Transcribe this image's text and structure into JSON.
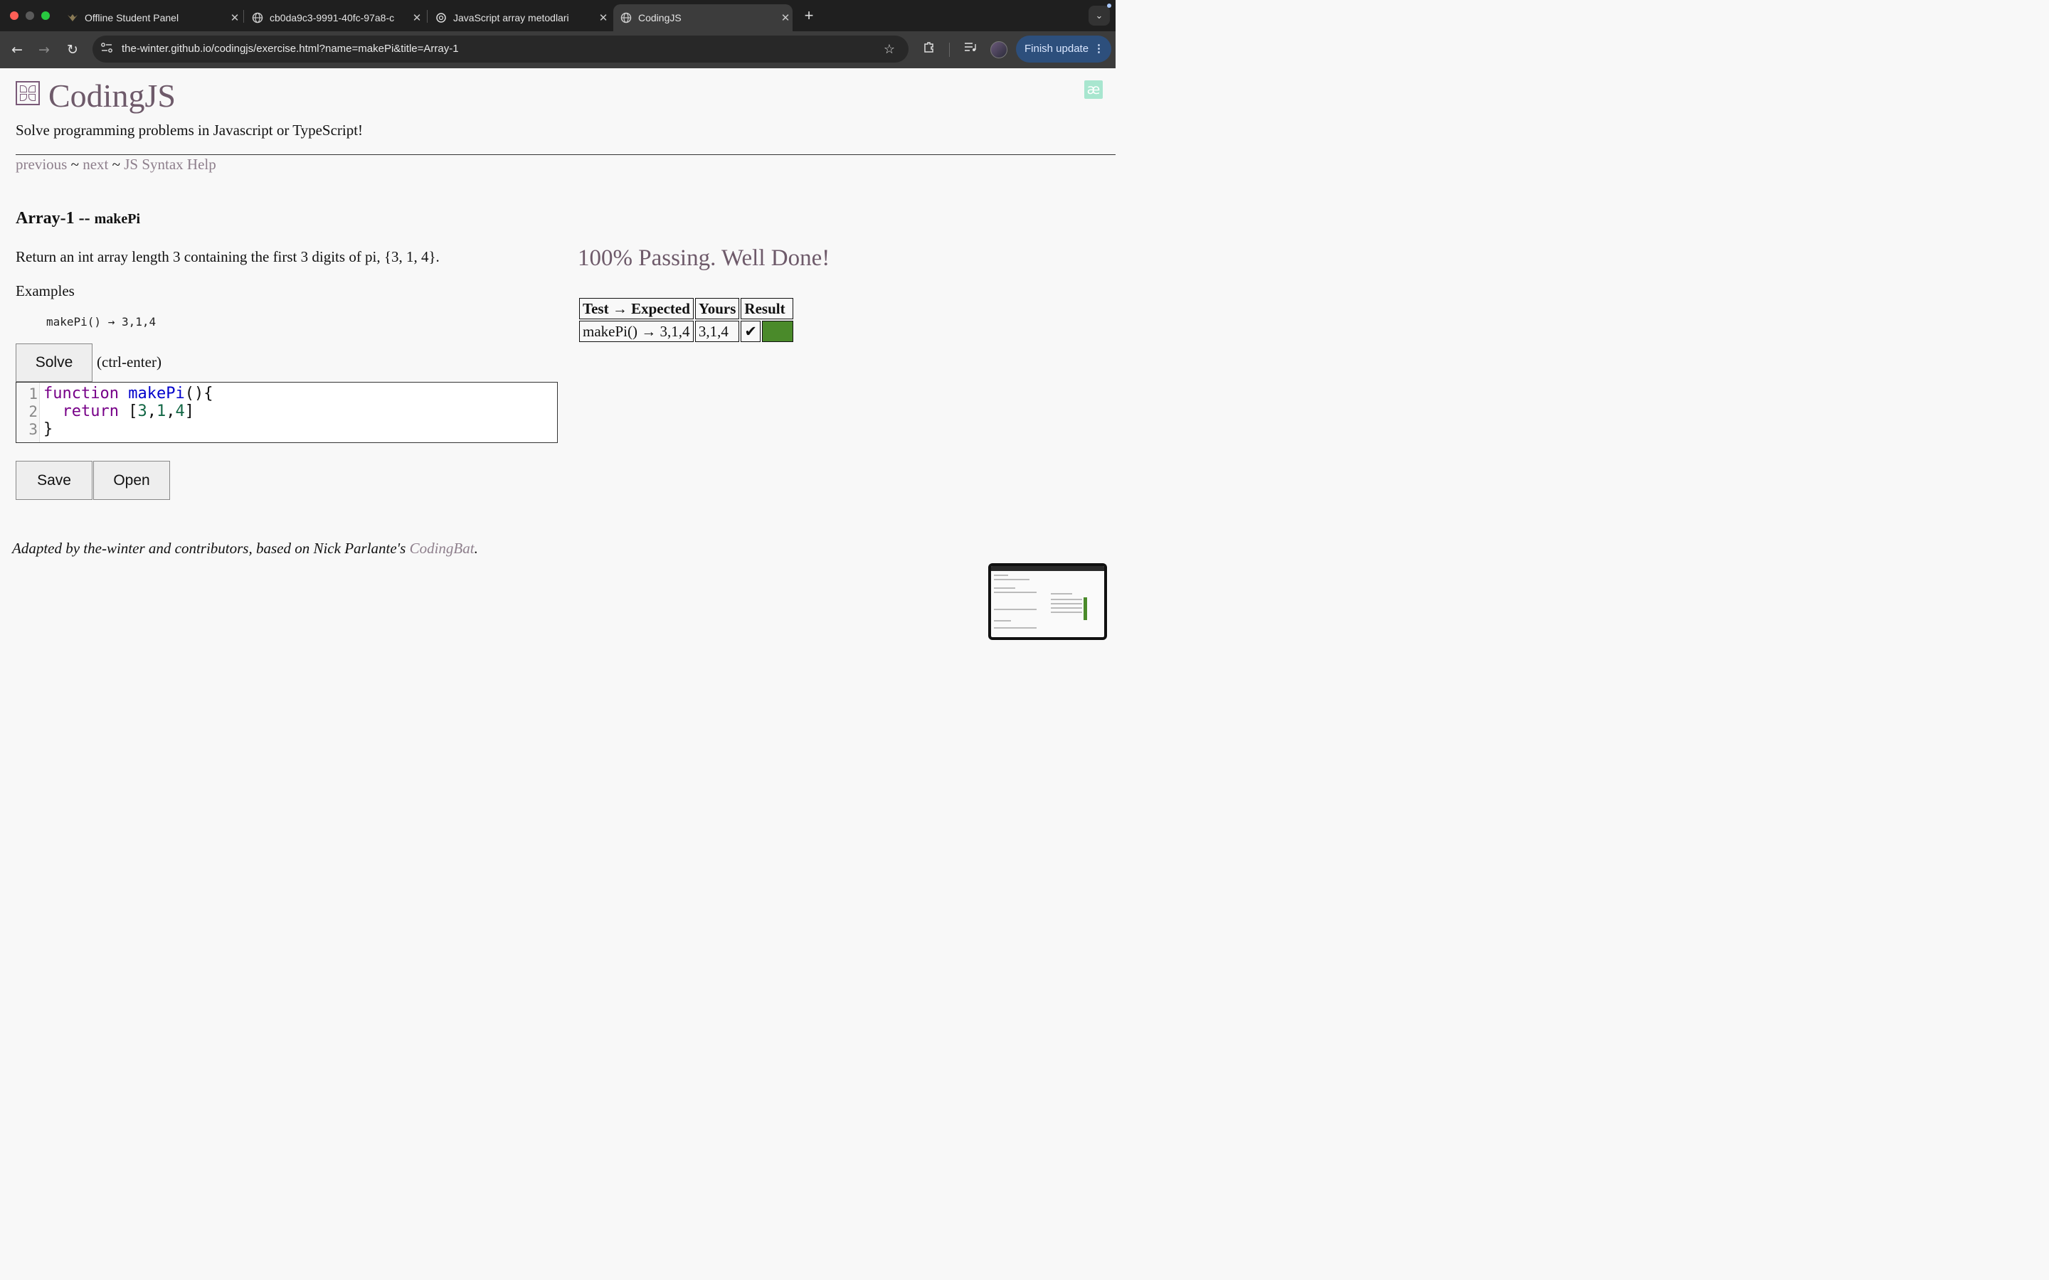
{
  "browser": {
    "tabs": [
      {
        "title": "Offline Student Panel",
        "icon": "paw-icon",
        "active": false
      },
      {
        "title": "cb0da9c3-9991-40fc-97a8-c",
        "icon": "globe-icon",
        "active": false
      },
      {
        "title": "JavaScript array metodlari",
        "icon": "openai-icon",
        "active": false
      },
      {
        "title": "CodingJS",
        "icon": "globe-icon",
        "active": true
      }
    ],
    "url": "the-winter.github.io/codingjs/exercise.html?name=makePi&title=Array-1",
    "update_label": "Finish update"
  },
  "page": {
    "site_title": "CodingJS",
    "ae_badge": "æ",
    "tagline": "Solve programming problems in Javascript or TypeScript!",
    "nav": {
      "previous": "previous",
      "next": "next",
      "syntax_help": "JS Syntax Help",
      "separator": "~"
    },
    "problem": {
      "category": "Array-1 --",
      "name": "makePi",
      "description": "Return an int array length 3 containing the first 3 digits of pi, {3, 1, 4}.",
      "examples_label": "Examples",
      "example": "makePi() → 3,1,4"
    },
    "solve_label": "Solve",
    "shortcut_hint": "(ctrl-enter)",
    "code": {
      "line_numbers": [
        "1",
        "2",
        "3"
      ],
      "kw_function": "function",
      "fn_name": "makePi",
      "parens": "(){",
      "kw_return": "return",
      "open_bracket": "[",
      "n1": "3",
      "n2": "1",
      "n3": "4",
      "comma": ",",
      "close_bracket": "]",
      "close_brace": "}"
    },
    "save_label": "Save",
    "open_label": "Open",
    "footer": {
      "text": "Adapted by the-winter and contributors, based on Nick Parlante's",
      "link": "CodingBat",
      "period": "."
    },
    "results": {
      "status": "100% Passing. Well Done!",
      "headers": [
        "Test → Expected",
        "Yours",
        "Result"
      ],
      "rows": [
        {
          "test": "makePi() → 3,1,4",
          "yours": "3,1,4",
          "check": "✔",
          "pass_color": "#4a8a2a"
        }
      ]
    }
  }
}
